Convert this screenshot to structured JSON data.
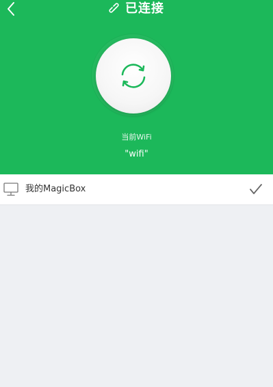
{
  "header": {
    "title": "已连接",
    "back_icon": "chevron-left-icon",
    "title_icon": "link-icon",
    "background_color": "#1cb85a"
  },
  "refresh": {
    "icon": "refresh-icon",
    "icon_color": "#1cb85a"
  },
  "wifi": {
    "label": "当前WiFi",
    "name": "\"wifi\""
  },
  "device": {
    "icon": "monitor-icon",
    "label": "我的MagicBox",
    "selected": true,
    "check_icon": "check-icon"
  }
}
